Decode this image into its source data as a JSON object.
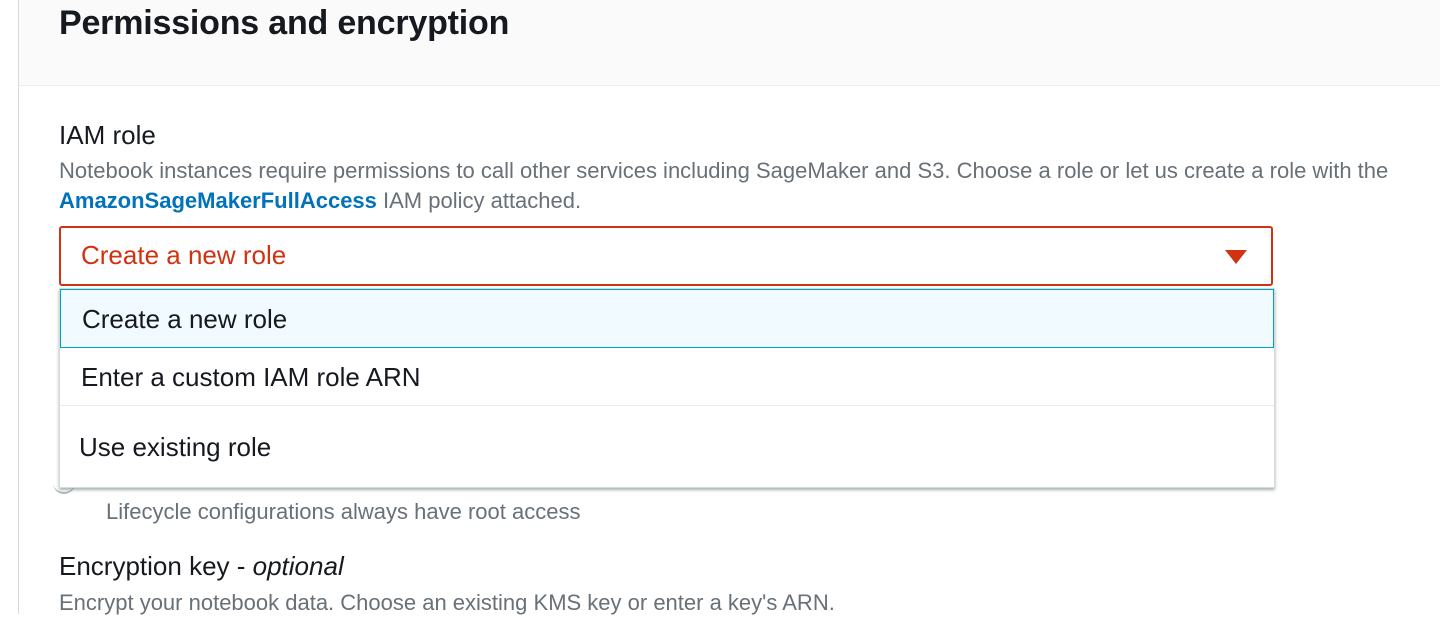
{
  "panel": {
    "title": "Permissions and encryption"
  },
  "iam_role": {
    "label": "IAM role",
    "description_line1": "Notebook instances require permissions to call other services including SageMaker and S3. Choose a role or let us create a role with the",
    "description_link": "AmazonSageMakerFullAccess",
    "description_line2_rest": " IAM policy attached.",
    "select": {
      "value": "Create a new role",
      "options": [
        "Create a new role",
        "Enter a custom IAM role ARN",
        "Use existing role"
      ]
    }
  },
  "lifecycle": {
    "note": "Lifecycle configurations always have root access"
  },
  "encryption": {
    "label": "Encryption key - ",
    "optional": "optional",
    "description": "Encrypt your notebook data. Choose an existing KMS key or enter a key's ARN."
  },
  "colors": {
    "error": "#d13212",
    "link": "#0073bb",
    "highlight_bg": "#f1faff",
    "highlight_border": "#00a1c9"
  }
}
